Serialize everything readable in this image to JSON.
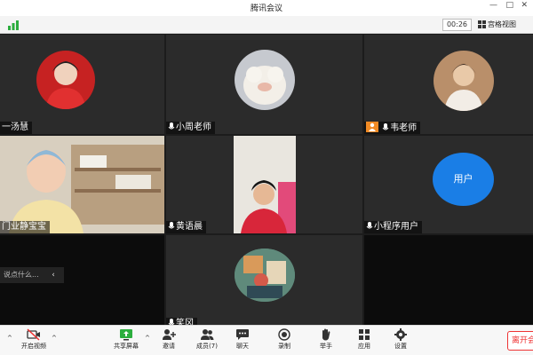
{
  "window": {
    "title": "腾讯会议"
  },
  "meeting": {
    "timer": "00:26",
    "view_label": "宫格视图"
  },
  "participants": [
    {
      "name": "一汤慧",
      "mic": false
    },
    {
      "name": "小周老师",
      "mic": true
    },
    {
      "name": "韦老师",
      "mic": true,
      "host_badge": true
    },
    {
      "name": "门业静宝宝",
      "mic": false
    },
    {
      "name": "黄语晨",
      "mic": true
    },
    {
      "name": "小程序用户",
      "mic": true,
      "avatar_text": "用户"
    },
    {
      "name": "笑冈",
      "mic": true
    }
  ],
  "chat": {
    "placeholder": "说点什么..."
  },
  "toolbar": {
    "video_label": "开启视频",
    "share_label": "共享屏幕",
    "invite_label": "邀请",
    "members_label": "成员(7)",
    "chat_label": "聊天",
    "record_label": "录制",
    "raise_hand_label": "举手",
    "apps_label": "应用",
    "settings_label": "设置",
    "leave_label": "离开会"
  },
  "colors": {
    "accent": "#1a7ee6",
    "leave": "#e33333",
    "host_badge": "#f08a24"
  }
}
